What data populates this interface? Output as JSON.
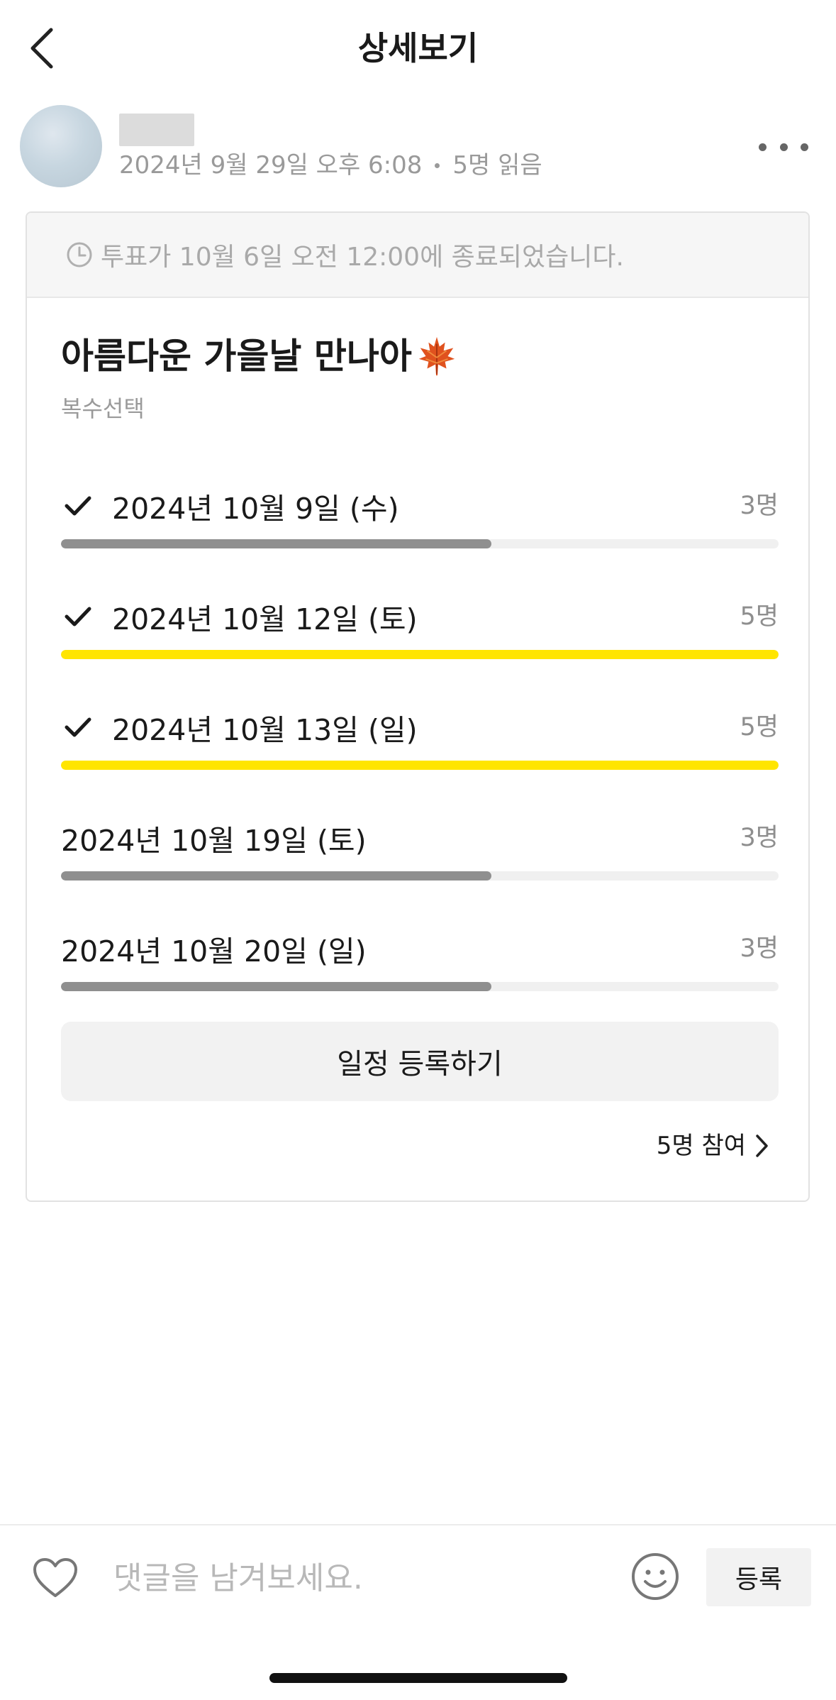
{
  "header": {
    "title": "상세보기"
  },
  "post": {
    "date": "2024년 9월 29일 오후 6:08",
    "reads": "5명 읽음"
  },
  "poll": {
    "banner": "투표가 10월 6일 오전 12:00에 종료되었습니다.",
    "title": "아름다운 가을날 만나아",
    "subtitle": "복수선택",
    "options": [
      {
        "label": "2024년 10월 9일 (수)",
        "count": "3명",
        "votes": 3,
        "selected": true
      },
      {
        "label": "2024년 10월 12일 (토)",
        "count": "5명",
        "votes": 5,
        "selected": true
      },
      {
        "label": "2024년 10월 13일 (일)",
        "count": "5명",
        "votes": 5,
        "selected": true
      },
      {
        "label": "2024년 10월 19일 (토)",
        "count": "3명",
        "votes": 3,
        "selected": false
      },
      {
        "label": "2024년 10월 20일 (일)",
        "count": "3명",
        "votes": 3,
        "selected": false
      }
    ],
    "max_votes": 5,
    "schedule_button": "일정 등록하기",
    "participants": "5명 참여"
  },
  "colors": {
    "bar_top": "#ffe500",
    "bar_normal": "#8f8f8f",
    "bar_track": "#f0f0f0"
  },
  "comment": {
    "placeholder": "댓글을 남겨보세요.",
    "submit_label": "등록"
  },
  "icons": {
    "back": "chevron-left-icon",
    "more": "more-horizontal-icon",
    "clock": "clock-icon",
    "title_emoji": "maple-leaf-icon",
    "check": "check-icon",
    "participants_arrow": "chevron-right-icon",
    "like": "heart-icon",
    "emoji": "smiley-icon"
  }
}
